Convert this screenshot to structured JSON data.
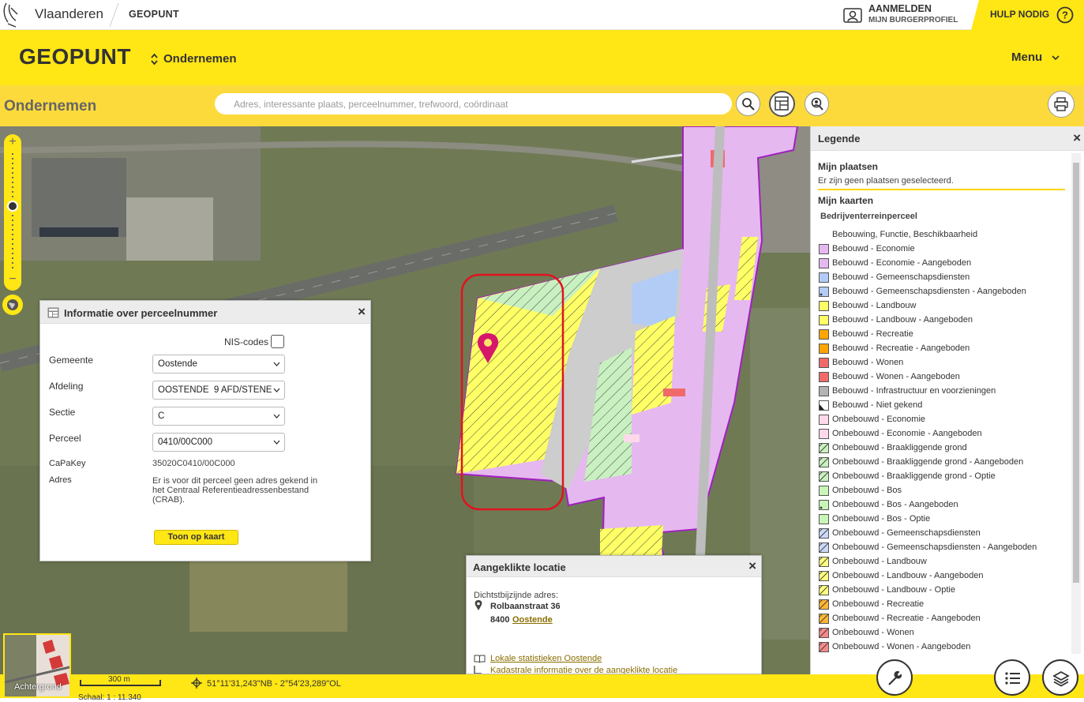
{
  "topbar": {
    "brand": "Vlaanderen",
    "subbrand": "GEOPUNT",
    "login_line1": "AANMELDEN",
    "login_line2": "MIJN BURGERPROFIEL",
    "help": "HULP NODIG"
  },
  "header": {
    "title": "GEOPUNT",
    "app_switch": "Ondernemen",
    "menu": "Menu"
  },
  "subheader": {
    "page_title": "Ondernemen",
    "search_placeholder": "Adres, interessante plaats, perceelnummer, trefwoord, coördinaat"
  },
  "info_panel": {
    "title": "Informatie over perceelnummer",
    "nis_label": "NIS-codes",
    "fields": [
      {
        "label": "Gemeente",
        "value": "Oostende"
      },
      {
        "label": "Afdeling",
        "value": "OOSTENDE  9 AFD/STENE"
      },
      {
        "label": "Sectie",
        "value": "C"
      },
      {
        "label": "Perceel",
        "value": "0410/00C000"
      }
    ],
    "capakey_label": "CaPaKey",
    "capakey_value": "35020C0410/00C000",
    "adres_label": "Adres",
    "adres_value": "Er is voor dit perceel geen adres gekend in het Centraal Referentieadressenbestand (CRAB).",
    "button": "Toon op kaart"
  },
  "location_panel": {
    "title": "Aangeklikte locatie",
    "nearest_label": "Dichtstbijzijnde adres:",
    "street": "Rolbaanstraat 36",
    "zip": "8400",
    "city": "Oostende",
    "link1": "Lokale statistieken Oostende",
    "link2": "Kadastrale informatie over de aangeklikte locatie"
  },
  "legend": {
    "title": "Legende",
    "my_places": "Mijn plaatsen",
    "no_places": "Er zijn geen plaatsen geselecteerd.",
    "my_maps": "Mijn kaarten",
    "layer": "Bedrijventerreinperceel",
    "items": [
      {
        "label": "Bebouwing, Functie, Beschikbaarheid",
        "color": "",
        "pattern": "none"
      },
      {
        "label": "Bebouwd - Economie",
        "color": "#e6b8f0",
        "pattern": "solid"
      },
      {
        "label": "Bebouwd - Economie - Aangeboden",
        "color": "#e6b8f0",
        "pattern": "solid"
      },
      {
        "label": "Bebouwd - Gemeenschapsdiensten",
        "color": "#b3ccf5",
        "pattern": "solid"
      },
      {
        "label": "Bebouwd - Gemeenschapsdiensten - Aangeboden",
        "color": "#b3ccf5",
        "pattern": "dot"
      },
      {
        "label": "Bebouwd - Landbouw",
        "color": "#ffff66",
        "pattern": "solid"
      },
      {
        "label": "Bebouwd - Landbouw - Aangeboden",
        "color": "#ffff66",
        "pattern": "solid"
      },
      {
        "label": "Bebouwd - Recreatie",
        "color": "#ffa500",
        "pattern": "solid"
      },
      {
        "label": "Bebouwd - Recreatie - Aangeboden",
        "color": "#ffa500",
        "pattern": "solid"
      },
      {
        "label": "Bebouwd - Wonen",
        "color": "#f06a6a",
        "pattern": "solid"
      },
      {
        "label": "Bebouwd - Wonen - Aangeboden",
        "color": "#f06a6a",
        "pattern": "solid"
      },
      {
        "label": "Bebouwd - Infrastructuur en voorzieningen",
        "color": "#b3b3b3",
        "pattern": "solid"
      },
      {
        "label": "Bebouwd - Niet gekend",
        "color": "#ffffff",
        "pattern": "corner"
      },
      {
        "label": "Onbebouwd - Economie",
        "color": "#ffd9ea",
        "pattern": "solid"
      },
      {
        "label": "Onbebouwd - Economie - Aangeboden",
        "color": "#ffd9ea",
        "pattern": "solid"
      },
      {
        "label": "Onbebouwd - Braakliggende grond",
        "color": "#c9f0c0",
        "pattern": "hatch"
      },
      {
        "label": "Onbebouwd - Braakliggende grond - Aangeboden",
        "color": "#c9f0c0",
        "pattern": "hatch"
      },
      {
        "label": "Onbebouwd - Braakliggende grond - Optie",
        "color": "#c9f0c0",
        "pattern": "hatch"
      },
      {
        "label": "Onbebouwd - Bos",
        "color": "#c9f5b8",
        "pattern": "solid"
      },
      {
        "label": "Onbebouwd - Bos - Aangeboden",
        "color": "#c9f5b8",
        "pattern": "dot"
      },
      {
        "label": "Onbebouwd - Bos - Optie",
        "color": "#c9f5b8",
        "pattern": "solid"
      },
      {
        "label": "Onbebouwd - Gemeenschapsdiensten",
        "color": "#cbd8f7",
        "pattern": "hatch"
      },
      {
        "label": "Onbebouwd - Gemeenschapsdiensten - Aangeboden",
        "color": "#cbd8f7",
        "pattern": "hatch"
      },
      {
        "label": "Onbebouwd - Landbouw",
        "color": "#ffff80",
        "pattern": "hatch"
      },
      {
        "label": "Onbebouwd - Landbouw - Aangeboden",
        "color": "#ffff80",
        "pattern": "hatch"
      },
      {
        "label": "Onbebouwd - Landbouw - Optie",
        "color": "#ffff80",
        "pattern": "hatch"
      },
      {
        "label": "Onbebouwd - Recreatie",
        "color": "#ffb733",
        "pattern": "hatch"
      },
      {
        "label": "Onbebouwd - Recreatie - Aangeboden",
        "color": "#ffb733",
        "pattern": "hatch"
      },
      {
        "label": "Onbebouwd - Wonen",
        "color": "#f58a8a",
        "pattern": "hatch"
      },
      {
        "label": "Onbebouwd - Wonen - Aangeboden",
        "color": "#f58a8a",
        "pattern": "hatch"
      }
    ]
  },
  "bottombar": {
    "background_label": "Achtergrond",
    "scale_bar": "300 m",
    "scale_text": "Schaal: 1 : 11.340",
    "coordinates": "51°11'31,243\"NB - 2°54'23,289\"OL"
  },
  "colors": {
    "accent_yellow": "#ffe615",
    "subheader_yellow": "#fdda3c",
    "link": "#8a6d00",
    "marker": "#d6186b",
    "selection": "#e0141e"
  }
}
